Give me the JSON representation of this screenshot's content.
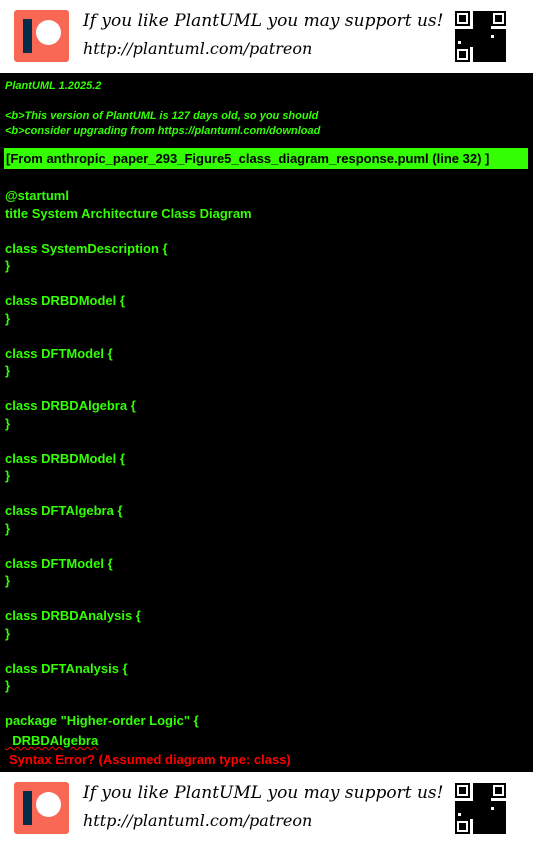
{
  "banner": {
    "line1": "If you like PlantUML you may support us!",
    "line2": "http://plantuml.com/patreon",
    "logo_icon": "patreon-logo",
    "qr_icon": "qr-code"
  },
  "console": {
    "version": "PlantUML 1.2025.2",
    "warning_line1": "<b>This version of PlantUML is 127 days old, so you should",
    "warning_line2": "<b>consider upgrading from https://plantuml.com/download",
    "source_ref": "[From anthropic_paper_293_Figure5_class_diagram_response.puml (line 32) ]",
    "code_lines": [
      "@startuml",
      "title System Architecture Class Diagram",
      "",
      "class SystemDescription {",
      "}",
      "",
      "class DRBDModel {",
      "}",
      "",
      "class DFTModel {",
      "}",
      "",
      "class DRBDAlgebra {",
      "}",
      "",
      "class DRBDModel {",
      "}",
      "",
      "class DFTAlgebra {",
      "}",
      "",
      "class DFTModel {",
      "}",
      "",
      "class DRBDAnalysis {",
      "}",
      "",
      "class DFTAnalysis {",
      "}",
      "",
      "package \"Higher-order Logic\" {"
    ],
    "error_line": "  DRBDAlgebra",
    "error_message": "Syntax Error? (Assumed diagram type: class)",
    "colors": {
      "background": "#000000",
      "text": "#33ff02",
      "error": "#ff0000",
      "patreon": "#f96854"
    }
  }
}
